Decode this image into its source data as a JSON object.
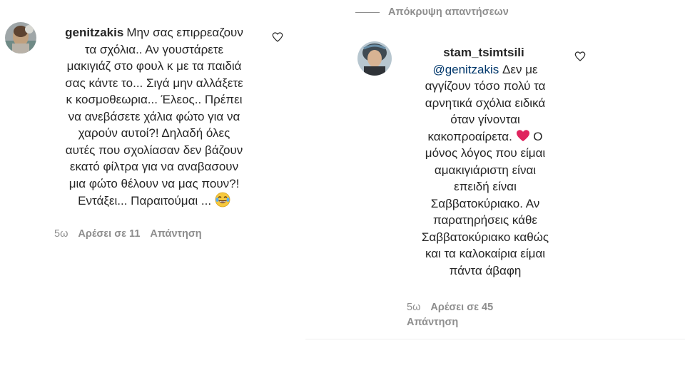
{
  "thread": {
    "hide_replies_label": "Απόκρυψη απαντήσεων"
  },
  "comment": {
    "username": "genitzakis",
    "text": "Μην σας επιρρεαζουν τα σχόλια.. Αν γουστάρετε μακιγιάζ στο φουλ κ με τα παιδιά σας κάντε το... Σιγά μην αλλάξετε κ κοσμοθεωρια... Έλεος.. Πρέπει να ανεβάσετε χάλια φώτο για να χαρούν αυτοί?! Δηλαδή όλες αυτές που σχολίασαν δεν βάζουν εκατό φίλτρα για να αναβασουν μια φώτο θέλουν να μας πουν?! Εντάξει... Παραιτούμαι ...",
    "lines": [
      "Μην σας επιρρεαζουν",
      "τα σχόλια.. Αν γουστάρετε",
      "μακιγιάζ στο φουλ κ με τα παιδιά",
      "σας κάντε το... Σιγά μην αλλάξετε",
      "κ κοσμοθεωρια... Έλεος.. Πρέπει",
      "να ανεβάσετε χάλια φώτο για να",
      "χαρούν αυτοί?! Δηλαδή όλες",
      "αυτές που σχολίασαν δεν βάζουν",
      "εκατό φίλτρα για να αναβασουν",
      "μια φώτο θέλουν να μας πουν?!",
      "Εντάξει... Παραιτούμαι ..."
    ],
    "emoji": "face-with-tears-of-joy",
    "time": "5ω",
    "likes_label": "Αρέσει σε 11",
    "reply_label": "Απάντηση"
  },
  "reply": {
    "username": "stam_tsimtsili",
    "mention": "@genitzakis",
    "text": "Δεν με αγγίζουν τόσο πολύ τα αρνητικά σχόλια ειδικά όταν γίνονται κακοπροαίρετα. Ο μόνος λόγος που είμαι αμακιγιάριστη είναι επειδή είναι Σαββατοκύριακο. Αν παρατηρήσεις κάθε Σαββατοκύριακο καθώς και τα καλοκαίρια είμαι πάντα άβαφη",
    "lines": [
      "Δεν με",
      "αγγίζουν τόσο πολύ τα",
      "αρνητικά σχόλια ειδικά",
      "όταν γίνονται",
      "κακοπροαίρετα.",
      "Ο",
      "μόνος λόγος που είμαι",
      "αμακιγιάριστη είναι",
      "επειδή είναι",
      "Σαββατοκύριακο. Αν",
      "παρατηρήσεις κάθε",
      "Σαββατοκύριακο καθώς",
      "και τα καλοκαίρια είμαι",
      "πάντα άβαφη"
    ],
    "emoji": "red-heart",
    "time": "5ω",
    "likes_label": "Αρέσει σε 45",
    "reply_label": "Απάντηση"
  },
  "colors": {
    "text": "#262626",
    "secondary": "#8e8e8e",
    "mention": "#00376b",
    "heart_emoji": "#e0245e"
  }
}
